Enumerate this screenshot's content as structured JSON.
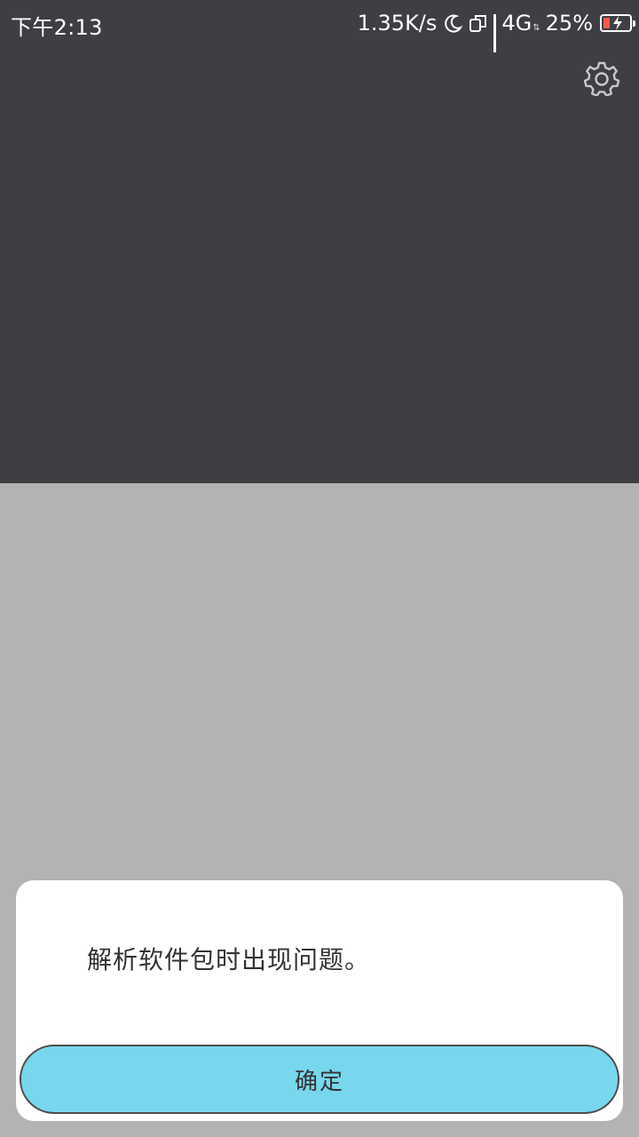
{
  "status_bar": {
    "time": "下午2:13",
    "net_speed": "1.35K/s",
    "network_type": "4G",
    "battery_percent": "25%",
    "battery_level": 0.25,
    "icons": [
      "moon-icon",
      "sim-icon",
      "signal-icon",
      "battery-charging-icon"
    ]
  },
  "settings": {
    "icon": "gear-icon"
  },
  "dialog": {
    "message": "解析软件包时出现问题。",
    "confirm_label": "确定"
  },
  "colors": {
    "top_panel": "#3e3f44",
    "overlay": "#b3b3b3",
    "dialog_bg": "#ffffff",
    "button_bg": "#78d7ed",
    "button_border": "#4d4d4d",
    "battery_low": "#ff5a4c"
  }
}
